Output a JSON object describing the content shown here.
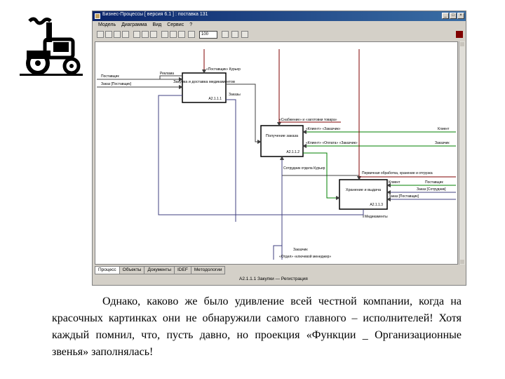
{
  "window": {
    "title": "Бизнес-Процессы [ версия 6.1 ] : поставка 131",
    "controls": [
      "_",
      "□",
      "×"
    ]
  },
  "menu": [
    "Модель",
    "Диаграмма",
    "Вид",
    "Сервис",
    "?"
  ],
  "toolbar": {
    "zoom": "100"
  },
  "boxes": [
    {
      "name": "Закупка и доставка медикаментов",
      "num": "А2.1.1.1"
    },
    {
      "name": "Получение заказа",
      "num": "А2.1.1.2"
    },
    {
      "name": "Хранение и выдача",
      "num": "А2.1.1.3"
    }
  ],
  "arrows": {
    "top1": "«Поставщик» Курьер",
    "left_in1": "Поставщик",
    "left_in2": "Заказ [Поставщик]",
    "box1_out": "Реклама",
    "box1_out2": "Заказы",
    "top2": "«Снабжение» и «заготовки товара»",
    "box2_in1": "«Клиент» «Заказчик»",
    "box2_in2": "«Клиент» «Оплата» «Заказчик»",
    "right_in1": "Клиент",
    "right_in2": "Заказчик",
    "box2_out": "Сотрудник отдела Курьер",
    "top3": "Первичная обработка, хранение и отгрузка",
    "box3_in1": "Клиент",
    "box3_in2": "Поставщик",
    "box3_in3": "Заказ [Сотрудник]",
    "box3_in4": "Заказ [Поставщик]",
    "right_in3": "Поставщик",
    "right_in4": "Заказ [Сотрудник]",
    "box3_out": "Медикаменты",
    "bottom1": "Заказчик",
    "bottom2": "«Отдел» «ключевой менеджер»"
  },
  "tabs": [
    "Процесс",
    "Объекты",
    "Документы",
    "IDEF",
    "Методологии"
  ],
  "status": "А2.1.1.1 Закупки — Регистрация",
  "caption": "Однако, каково же было удивление всей честной компании, когда на красочных картинках они не обнаружили самого главного – исполнителей! Хотя каждый помнил, что, пусть давно, но проекция «Функции _ Организационные звенья» заполнялась!"
}
